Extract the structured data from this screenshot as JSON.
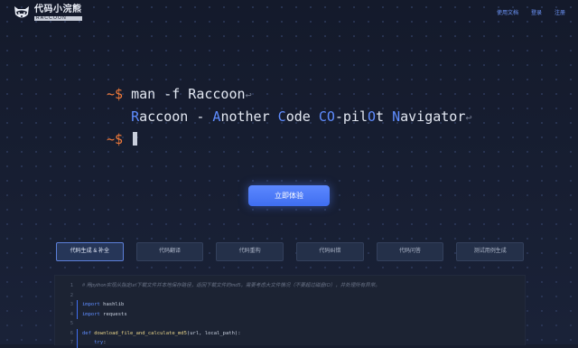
{
  "header": {
    "logo_cn": "代码小浣熊",
    "logo_en": "RACCOON",
    "nav": [
      "使用文档",
      "登录",
      "注册"
    ]
  },
  "terminal": {
    "prompt": "~$",
    "line1_cmd": "man -f Raccoon",
    "line2": [
      {
        "t": "R",
        "h": true
      },
      {
        "t": "accoon - ",
        "h": false
      },
      {
        "t": "A",
        "h": true
      },
      {
        "t": "nother ",
        "h": false
      },
      {
        "t": "C",
        "h": true
      },
      {
        "t": "ode ",
        "h": false
      },
      {
        "t": "CO",
        "h": true
      },
      {
        "t": "-pil",
        "h": false
      },
      {
        "t": "O",
        "h": true
      },
      {
        "t": "t ",
        "h": false
      },
      {
        "t": "N",
        "h": true
      },
      {
        "t": "avigator",
        "h": false
      }
    ],
    "return_glyph": "↩"
  },
  "cta": {
    "label": "立即体验"
  },
  "tabs": [
    "代码生成 & 补全",
    "代码翻译",
    "代码重构",
    "代码纠错",
    "代码问答",
    "测试用例生成"
  ],
  "active_tab": 0,
  "code": {
    "lines": [
      {
        "n": "1",
        "parts": [
          {
            "c": "cm",
            "t": "# 用python实现从指定url下载文件并本地保存路径，返回下载文件的md5，需要考虑大文件情况（不要超过磁盘IO），并处理所有异常。"
          }
        ]
      },
      {
        "n": "2",
        "parts": []
      },
      {
        "n": "3",
        "parts": [
          {
            "c": "kw",
            "t": "import"
          },
          {
            "c": "",
            "t": " hashlib"
          }
        ]
      },
      {
        "n": "4",
        "parts": [
          {
            "c": "kw",
            "t": "import"
          },
          {
            "c": "",
            "t": " requests"
          }
        ]
      },
      {
        "n": "5",
        "parts": []
      },
      {
        "n": "6",
        "parts": [
          {
            "c": "kw",
            "t": "def"
          },
          {
            "c": "",
            "t": " "
          },
          {
            "c": "fn",
            "t": "download_file_and_calculate_md5"
          },
          {
            "c": "",
            "t": "(url, local_path):"
          }
        ]
      },
      {
        "n": "7",
        "parts": [
          {
            "c": "",
            "t": "    "
          },
          {
            "c": "kw",
            "t": "try"
          },
          {
            "c": "",
            "t": ":"
          }
        ]
      }
    ]
  }
}
